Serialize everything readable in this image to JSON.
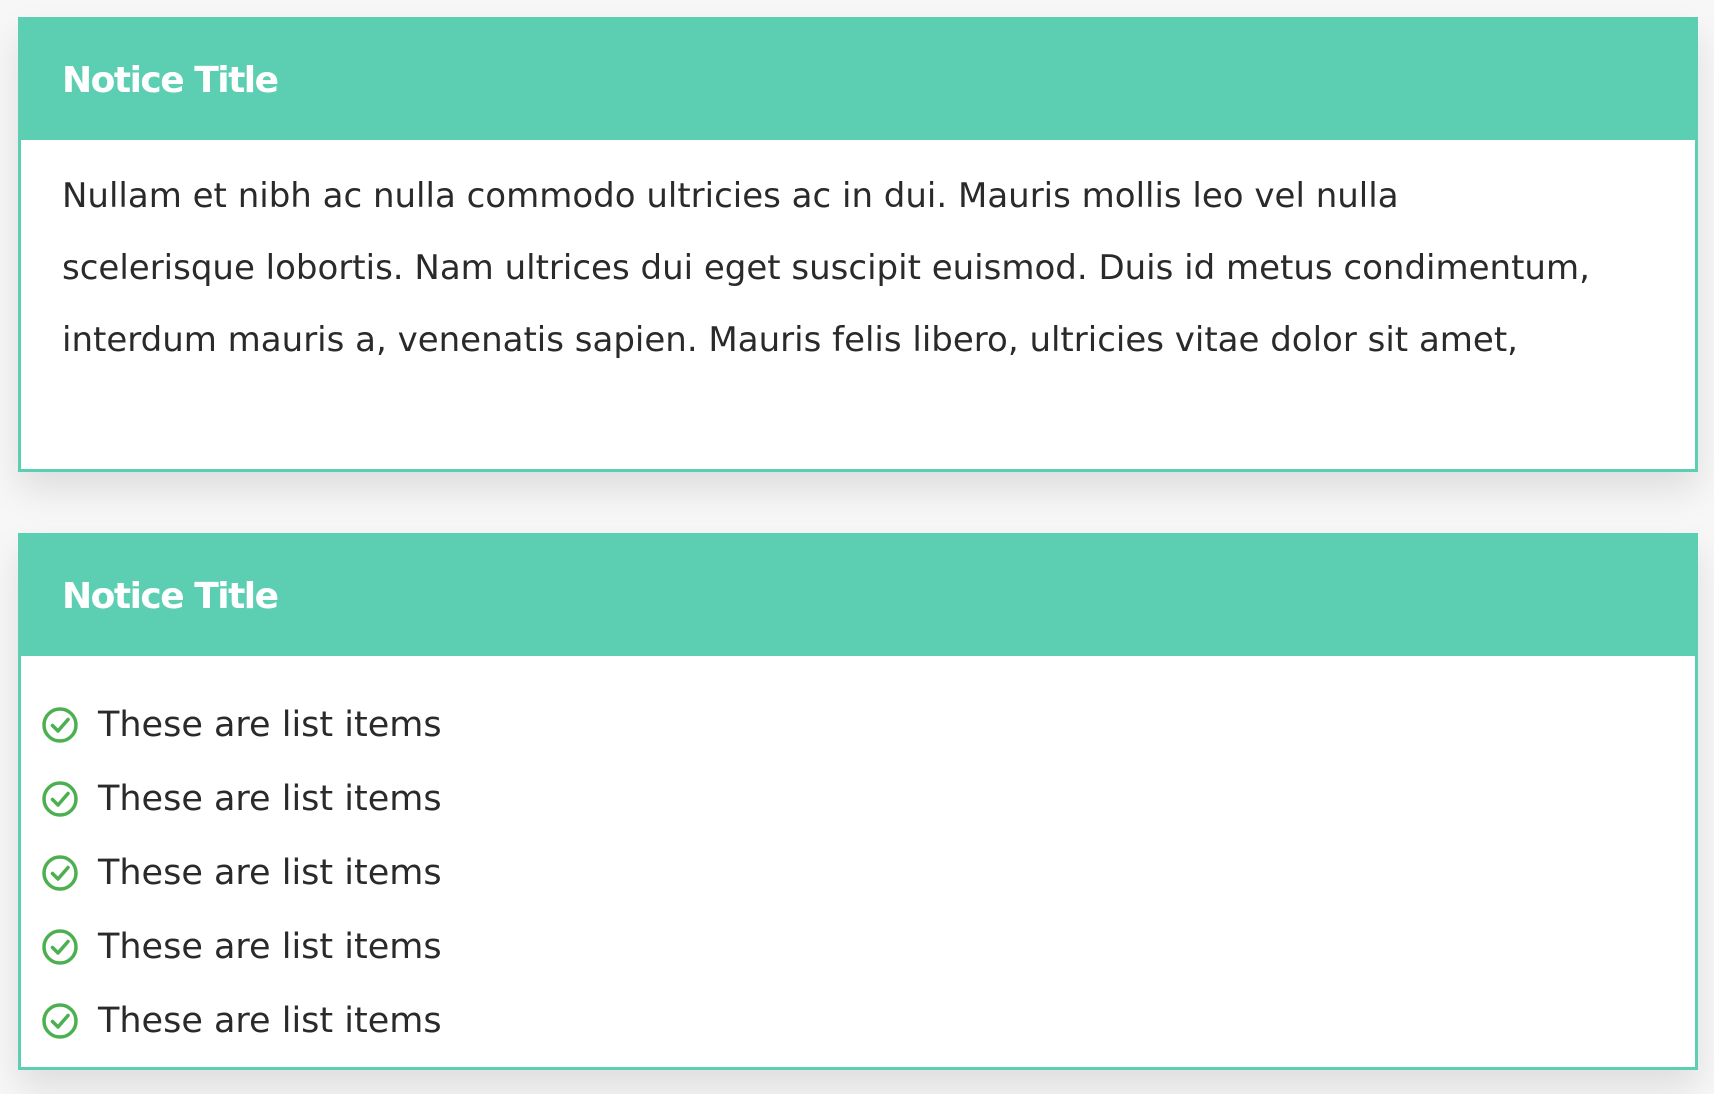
{
  "notices": [
    {
      "title": "Notice Title",
      "body": "Nullam et nibh ac nulla commodo ultricies ac in dui. Mauris mollis leo vel nulla scelerisque lobortis. Nam ultrices dui eget suscipit euismod. Duis id metus condimentum, interdum mauris a, venenatis sapien. Mauris felis libero, ultricies vitae dolor sit amet,"
    },
    {
      "title": "Notice Title",
      "items": [
        "These are list items",
        "These are list items",
        "These are list items",
        "These are list items",
        "These are list items"
      ],
      "item_icon": "check-circle-icon"
    }
  ],
  "colors": {
    "accent": "#5ccfb3",
    "check": "#4caf50",
    "text": "#2a2a2a"
  }
}
